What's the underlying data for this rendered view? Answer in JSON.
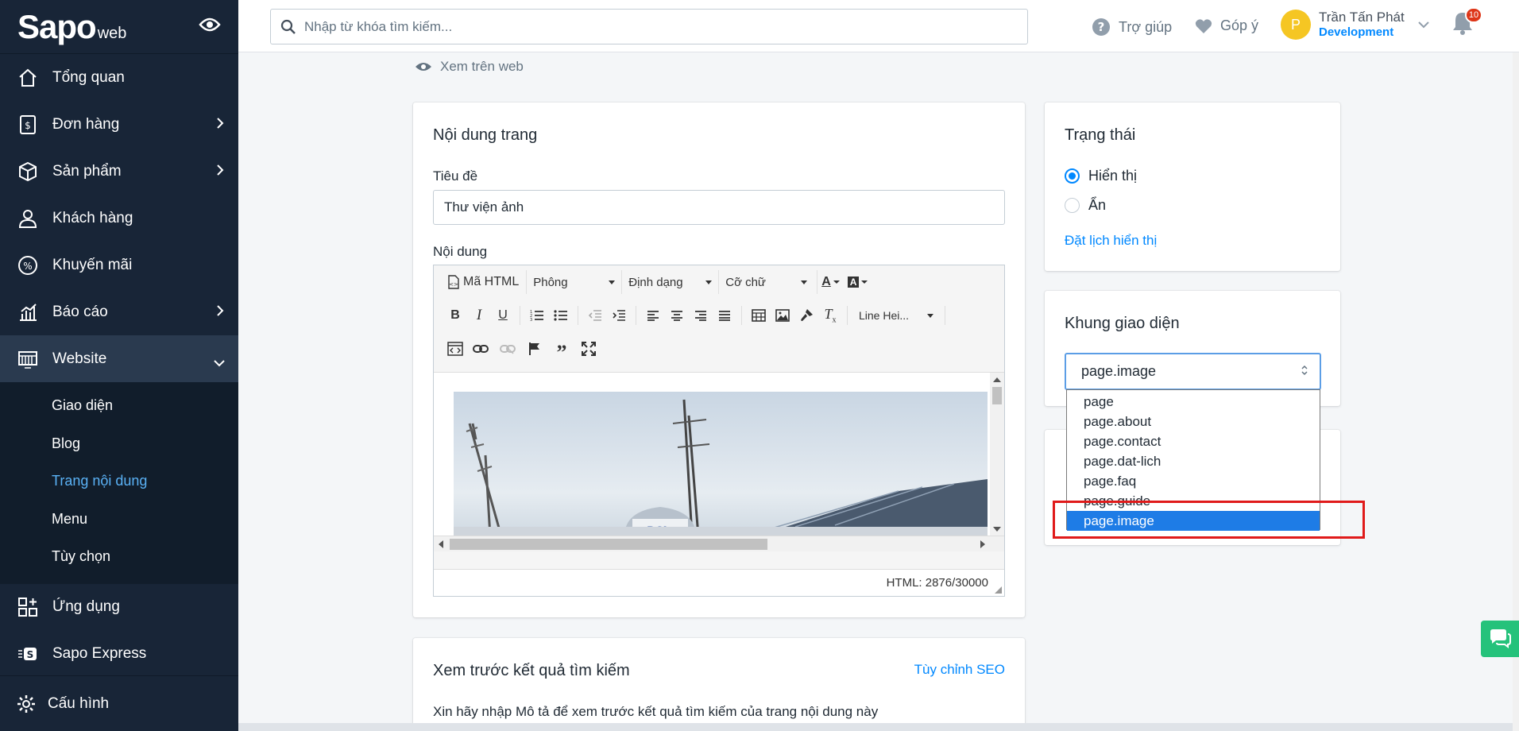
{
  "sidebar": {
    "logo_main": "Sapo",
    "logo_sub": "web",
    "items": [
      {
        "label": "Tổng quan",
        "icon": "home-icon"
      },
      {
        "label": "Đơn hàng",
        "icon": "order-icon"
      },
      {
        "label": "Sản phẩm",
        "icon": "box-icon"
      },
      {
        "label": "Khách hàng",
        "icon": "user-icon"
      },
      {
        "label": "Khuyến mãi",
        "icon": "discount-icon"
      },
      {
        "label": "Báo cáo",
        "icon": "report-icon"
      },
      {
        "label": "Website",
        "icon": "website-icon"
      }
    ],
    "website_sub": [
      "Giao diện",
      "Blog",
      "Trang nội dung",
      "Menu",
      "Tùy chọn"
    ],
    "apps_label": "Ứng dụng",
    "express_label": "Sapo Express",
    "settings_label": "Cấu hình"
  },
  "topbar": {
    "search_placeholder": "Nhập từ khóa tìm kiếm...",
    "help": "Trợ giúp",
    "feedback": "Góp ý",
    "user_initial": "P",
    "user_name": "Trần Tấn Phát",
    "user_role": "Development",
    "notif_count": "10"
  },
  "view_on_web": "Xem trên web",
  "content_card": {
    "title": "Nội dung trang",
    "title_label": "Tiêu đề",
    "title_value": "Thư viện ảnh",
    "content_label": "Nội dung",
    "toolbar": {
      "html": "Mã HTML",
      "font": "Phông",
      "format": "Định dạng",
      "size": "Cỡ chữ",
      "line_height": "Line Hei..."
    },
    "html_count": "HTML: 2876/30000"
  },
  "status_card": {
    "title": "Trạng thái",
    "visible": "Hiển thị",
    "hidden": "Ẩn",
    "schedule": "Đặt lịch hiển thị"
  },
  "template_card": {
    "title": "Khung giao diện",
    "selected": "page.image",
    "options": [
      "page",
      "page.about",
      "page.contact",
      "page.dat-lich",
      "page.faq",
      "page.guide",
      "page.image"
    ]
  },
  "seo_card": {
    "title": "Xem trước kết quả tìm kiếm",
    "customize": "Tùy chỉnh SEO",
    "hint": "Xin hãy nhập Mô tả để xem trước kết quả tìm kiếm của trang nội dung này"
  },
  "colors": {
    "sidebar": "#182537",
    "accent": "#0088ff",
    "highlight": "#1e7ce6",
    "chat": "#25c27b"
  }
}
